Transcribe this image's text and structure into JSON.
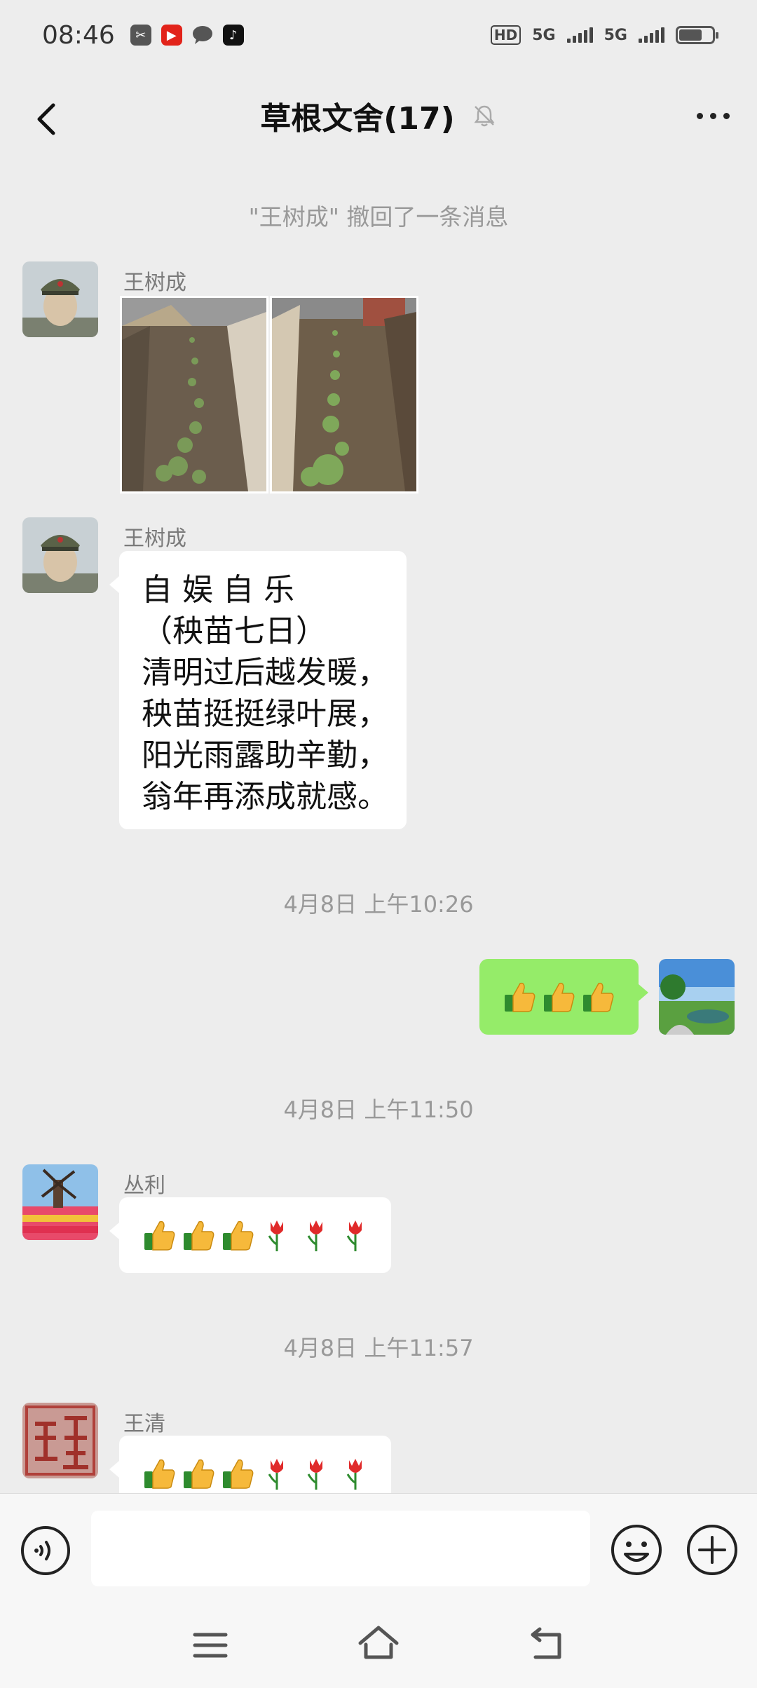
{
  "status_bar": {
    "time": "08:46",
    "hd_label": "HD",
    "net1": "5G",
    "net2": "5G",
    "battery_level": 0.7
  },
  "header": {
    "title": "草根文舍(17)"
  },
  "messages": {
    "recall_notice": "\"王树成\" 撤回了一条消息",
    "m1": {
      "sender": "王树成"
    },
    "m2": {
      "sender": "王树成",
      "lines": [
        "自 娱 自 乐",
        "（秧苗七日）",
        "清明过后越发暖，",
        "秧苗挺挺绿叶展，",
        "阳光雨露助辛勤，",
        "翁年再添成就感。"
      ]
    },
    "t1": "4月8日 上午10:26",
    "t2": "4月8日 上午11:50",
    "m4": {
      "sender": "丛利"
    },
    "t3": "4月8日 上午11:57",
    "m5": {
      "sender": "王清"
    }
  },
  "input": {
    "placeholder": ""
  },
  "colors": {
    "accent_green": "#95ec69",
    "background": "#ededed"
  }
}
